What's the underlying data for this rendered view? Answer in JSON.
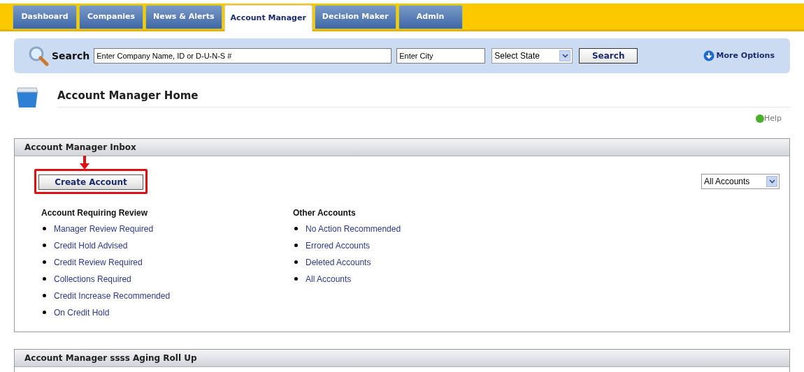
{
  "tabs": [
    {
      "label": "Dashboard",
      "selected": false
    },
    {
      "label": "Companies",
      "selected": false
    },
    {
      "label": "News & Alerts",
      "selected": false
    },
    {
      "label": "Account Manager",
      "selected": true
    },
    {
      "label": "Decision Maker",
      "selected": false
    },
    {
      "label": "Admin",
      "selected": false
    }
  ],
  "search": {
    "label": "Search",
    "company_field": {
      "value": "Enter Company Name, ID or D-U-N-S #"
    },
    "city_field": {
      "value": "Enter City"
    },
    "state_select": {
      "value": "Select State"
    },
    "button": "Search",
    "more_options": "More Options"
  },
  "page_title": "Account Manager Home",
  "help": "Help",
  "inbox": {
    "title": "Account Manager Inbox",
    "create_button": "Create Account",
    "highlighted": true,
    "filter": {
      "value": "All Accounts"
    },
    "groups": [
      {
        "heading": "Account Requiring Review",
        "links": [
          "Manager Review Required",
          "Credit Hold Advised",
          "Credit Review Required",
          "Collections Required",
          "Credit Increase Recommended",
          "On Credit Hold"
        ]
      },
      {
        "heading": "Other Accounts",
        "links": [
          "No Action Recommended",
          "Errored Accounts",
          "Deleted Accounts",
          "All Accounts"
        ]
      }
    ]
  },
  "rollup": {
    "title": "Account Manager ssss Aging Roll Up"
  }
}
